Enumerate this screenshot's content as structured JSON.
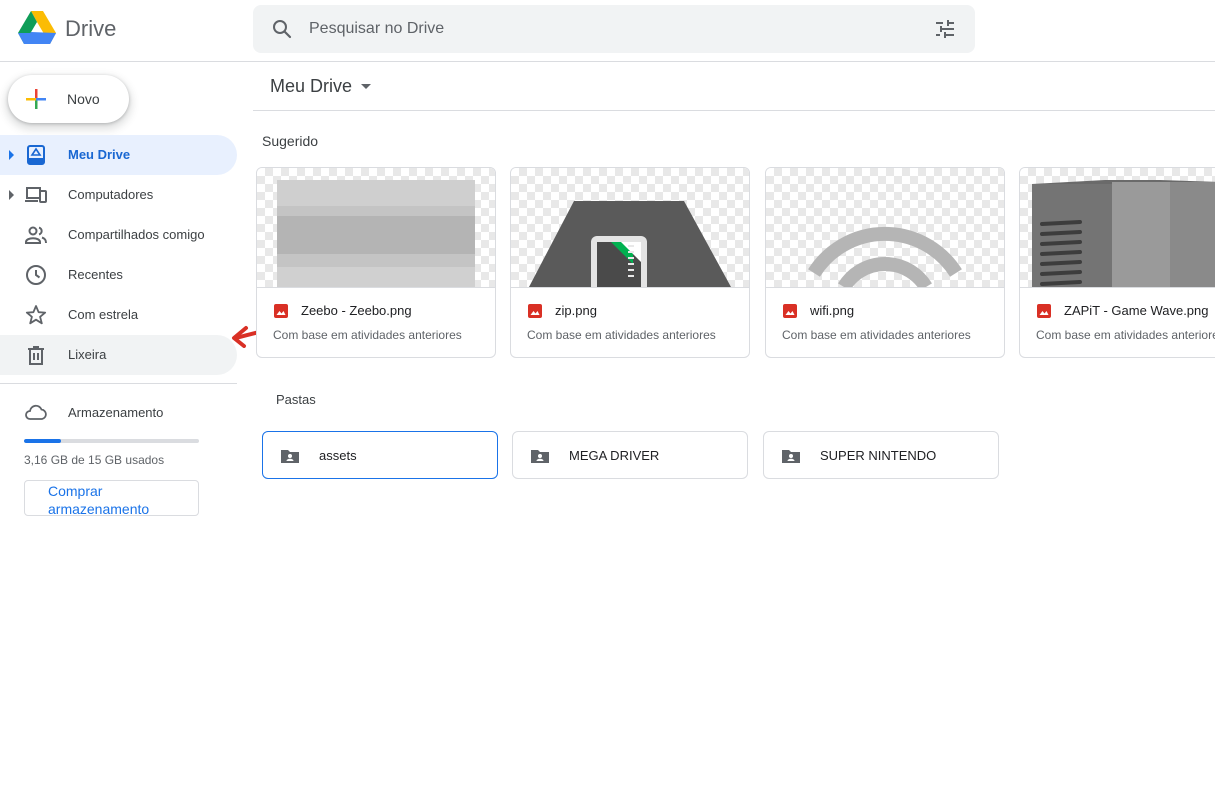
{
  "header": {
    "app_name": "Drive",
    "search_placeholder": "Pesquisar no Drive"
  },
  "sidebar": {
    "new_label": "Novo",
    "items": [
      {
        "label": "Meu Drive",
        "icon": "my-drive-icon",
        "active": true
      },
      {
        "label": "Computadores",
        "icon": "computers-icon"
      },
      {
        "label": "Compartilhados comigo",
        "icon": "shared-icon"
      },
      {
        "label": "Recentes",
        "icon": "clock-icon"
      },
      {
        "label": "Com estrela",
        "icon": "star-icon"
      },
      {
        "label": "Lixeira",
        "icon": "trash-icon"
      }
    ],
    "storage": {
      "label": "Armazenamento",
      "usage_text": "3,16 GB de 15 GB usados",
      "used_fraction": 0.21,
      "buy_label": "Comprar armazenamento"
    }
  },
  "main": {
    "breadcrumb": "Meu Drive",
    "suggested_title": "Sugerido",
    "suggested": [
      {
        "name": "Zeebo - Zeebo.png",
        "subtitle": "Com base em atividades anteriores"
      },
      {
        "name": "zip.png",
        "subtitle": "Com base em atividades anteriores"
      },
      {
        "name": "wifi.png",
        "subtitle": "Com base em atividades anteriores"
      },
      {
        "name": "ZAPiT - Game Wave.png",
        "subtitle": "Com base em atividades anteriores"
      }
    ],
    "folders_title": "Pastas",
    "folders": [
      {
        "name": "assets",
        "selected": true
      },
      {
        "name": "MEGA DRIVER"
      },
      {
        "name": "SUPER NINTENDO"
      }
    ]
  },
  "colors": {
    "accent": "#1a73e8",
    "active_nav_bg": "#e8f0fe",
    "image_icon": "#d93025",
    "annotation_arrow": "#d93025"
  }
}
